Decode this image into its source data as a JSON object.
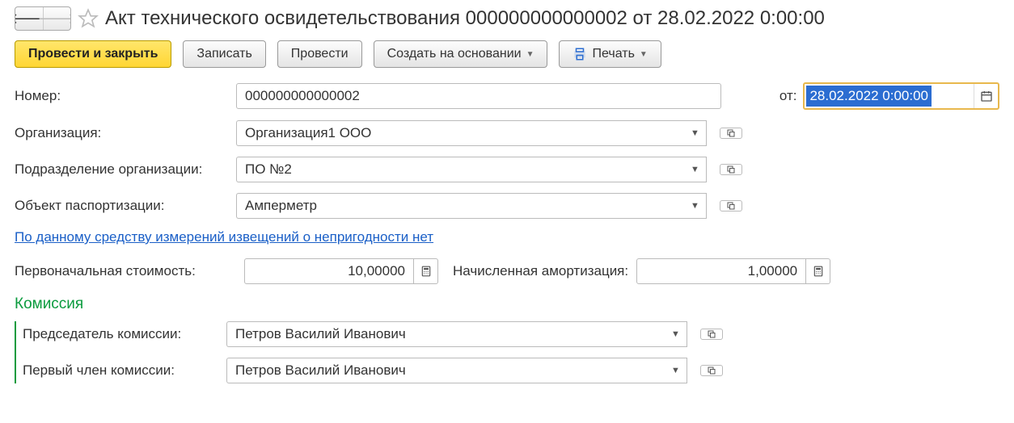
{
  "header": {
    "title": "Акт технического освидетельствования 000000000000002 от 28.02.2022 0:00:00"
  },
  "toolbar": {
    "post_close": "Провести и закрыть",
    "save": "Записать",
    "post": "Провести",
    "create_based": "Создать на основании",
    "print": "Печать"
  },
  "fields": {
    "number_label": "Номер:",
    "number_value": "000000000000002",
    "date_label": "от:",
    "date_value": "28.02.2022  0:00:00",
    "org_label": "Организация:",
    "org_value": "Организация1 ООО",
    "dept_label": "Подразделение организации:",
    "dept_value": "ПО №2",
    "object_label": "Объект паспортизации:",
    "object_value": "Амперметр"
  },
  "link": "По данному средству измерений извещений о непригодности нет",
  "costs": {
    "initial_label": "Первоначальная стоимость:",
    "initial_value": "10,00000",
    "amort_label": "Начисленная амортизация:",
    "amort_value": "1,00000"
  },
  "commission": {
    "section_title": "Комиссия",
    "chair_label": "Председатель комиссии:",
    "chair_value": "Петров Василий Иванович",
    "member1_label": "Первый член комиссии:",
    "member1_value": "Петров Василий Иванович"
  }
}
